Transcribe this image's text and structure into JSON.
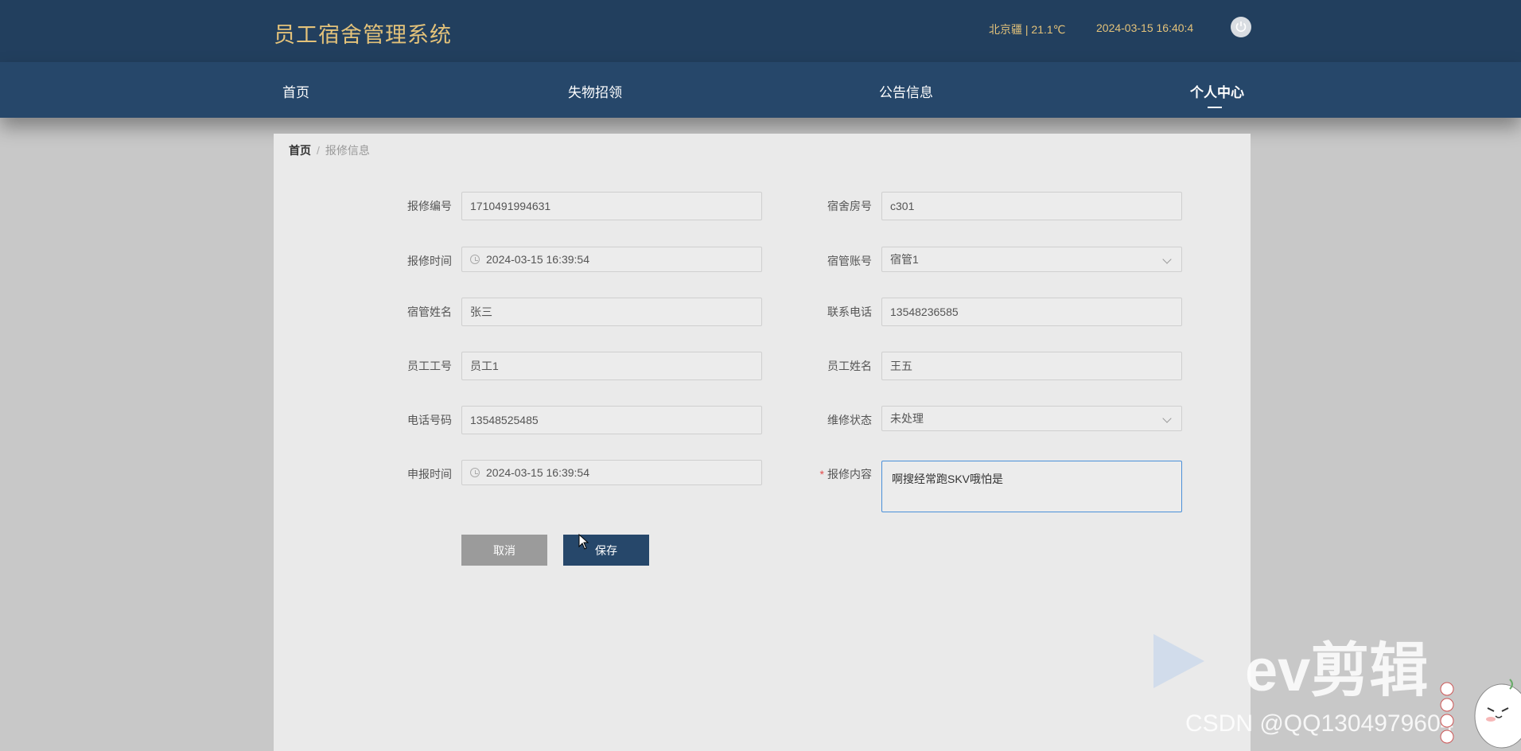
{
  "app": {
    "title": "员工宿舍管理系统",
    "weather": "北京疆 | 21.1℃",
    "datetime": "2024-03-15   16:40:4"
  },
  "nav": {
    "items": [
      {
        "label": "首页",
        "active": false
      },
      {
        "label": "失物招领",
        "active": false
      },
      {
        "label": "公告信息",
        "active": false
      },
      {
        "label": "个人中心",
        "active": true
      }
    ]
  },
  "breadcrumb": {
    "home": "首页",
    "separator": "/",
    "current": "报修信息"
  },
  "form": {
    "repair_no": {
      "label": "报修编号",
      "value": "1710491994631"
    },
    "dorm_room": {
      "label": "宿舍房号",
      "value": "c301"
    },
    "repair_time": {
      "label": "报修时间",
      "value": "2024-03-15 16:39:54"
    },
    "manager_account": {
      "label": "宿管账号",
      "value": "宿管1"
    },
    "manager_name": {
      "label": "宿管姓名",
      "value": "张三"
    },
    "contact_phone": {
      "label": "联系电话",
      "value": "13548236585"
    },
    "employee_id": {
      "label": "员工工号",
      "value": "员工1"
    },
    "employee_name": {
      "label": "员工姓名",
      "value": "王五"
    },
    "phone": {
      "label": "电话号码",
      "value": "13548525485"
    },
    "repair_status": {
      "label": "维修状态",
      "value": "未处理"
    },
    "report_time": {
      "label": "申报时间",
      "value": "2024-03-15 16:39:54"
    },
    "repair_content": {
      "label": "报修内容",
      "required_mark": "*",
      "value": "啊搜经常跑SKV哦怕是"
    }
  },
  "buttons": {
    "cancel": "取消",
    "save": "保存"
  },
  "watermark": {
    "brand": "ev剪辑",
    "csdn": "CSDN @QQ1304979604"
  },
  "colors": {
    "header_bg": "#223f5e",
    "nav_bg": "#26476a",
    "title_gold": "#e3c27a",
    "save_button": "#26476a",
    "cancel_button": "#9b9b9b"
  }
}
